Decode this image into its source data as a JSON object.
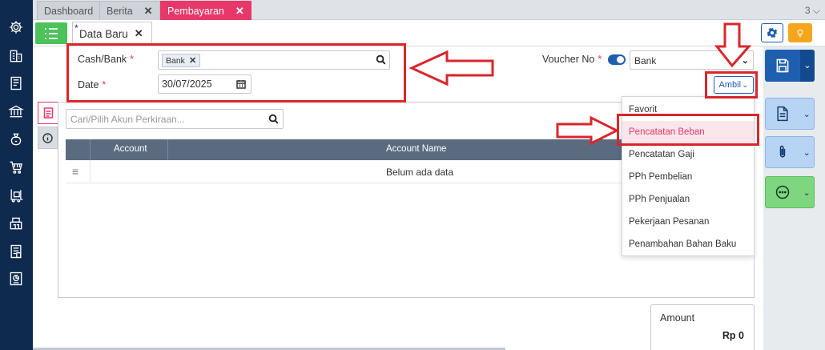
{
  "tabs": [
    {
      "label": "Dashboard",
      "closable": false
    },
    {
      "label": "Berita",
      "closable": true
    },
    {
      "label": "Pembayaran",
      "closable": true,
      "active": true
    }
  ],
  "tab_close_glyph": "✕",
  "tab_count": "3",
  "tab_count_chevron": "⌵",
  "subtabs": {
    "doc_star": "*",
    "doc_label": "Data Baru",
    "doc_close": "✕"
  },
  "form": {
    "cash_bank_label": "Cash/Bank",
    "required_mark": "*",
    "cash_bank_value": "Bank",
    "chip_close": "✕",
    "date_label": "Date",
    "date_value": "30/07/2025",
    "voucher_label": "Voucher No",
    "voucher_value": "Bank",
    "select_chevron": "⌄",
    "ambil_label": "Ambil",
    "ambil_chevron": "⌄"
  },
  "accounts": {
    "search_placeholder": "Cari/Pilih Akun Perkiraan...",
    "columns": [
      "Account",
      "Account Name"
    ],
    "row_grip": "≡",
    "empty_text": "Belum ada data"
  },
  "amount": {
    "label": "Amount",
    "value": "Rp 0"
  },
  "dropdown": {
    "items": [
      "Favorit",
      "Pencatatan Beban",
      "Pencatatan Gaji",
      "PPh Pembelian",
      "PPh Penjualan",
      "Pekerjaan Pesanan",
      "Penambahan Bahan Baku"
    ],
    "highlighted_index": 1
  },
  "actions": {
    "dropdown_chevron": "⌄"
  },
  "colors": {
    "nav_bg": "#0f2a4f",
    "accent_pink": "#e8386a",
    "primary_blue": "#1e5fb0",
    "green": "#4bc25a",
    "orange": "#f4a71d",
    "annotation_red": "#d9262b"
  },
  "icons": {
    "nav": [
      "gear-icon",
      "building-icon",
      "book-icon",
      "bank-icon",
      "money-bag-icon",
      "cart-icon",
      "forklift-icon",
      "warehouse-icon",
      "tax-icon",
      "report-icon"
    ],
    "toolbar": [
      "list-icon",
      "settings-icon",
      "lightbulb-icon"
    ],
    "actions": [
      "save-icon",
      "document-icon",
      "paperclip-icon",
      "more-icon"
    ]
  }
}
